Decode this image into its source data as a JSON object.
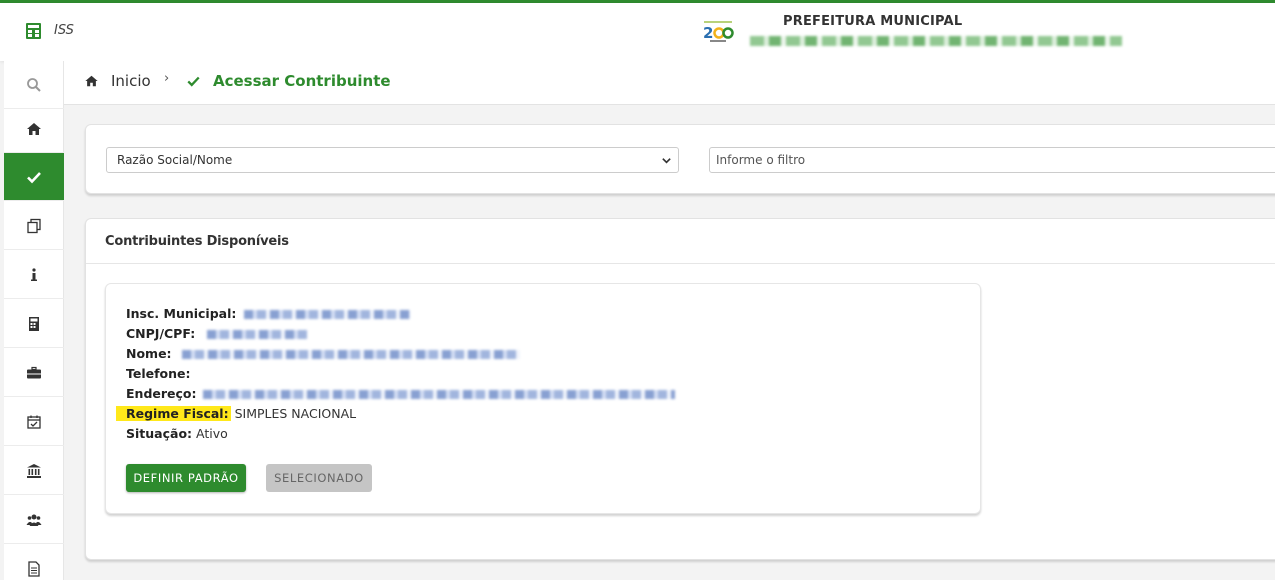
{
  "header": {
    "app_name": "ISS",
    "org_name": "PREFEITURA MUNICIPAL"
  },
  "sidebar": {
    "items": [
      {
        "icon": "search-icon"
      },
      {
        "icon": "home-icon"
      },
      {
        "icon": "check-icon",
        "active": true
      },
      {
        "icon": "copy-icon"
      },
      {
        "icon": "info-icon"
      },
      {
        "icon": "calculator-icon"
      },
      {
        "icon": "briefcase-icon"
      },
      {
        "icon": "calendar-check-icon"
      },
      {
        "icon": "bank-icon"
      },
      {
        "icon": "users-icon"
      },
      {
        "icon": "document-icon"
      }
    ]
  },
  "breadcrumb": {
    "home": "Inicio",
    "separator": "›",
    "current": "Acessar Contribuinte"
  },
  "filter": {
    "select_value": "Razão Social/Nome",
    "input_placeholder": "Informe o filtro"
  },
  "contribuintes": {
    "title": "Contribuintes Disponíveis",
    "labels": {
      "insc": "Insc. Municipal:",
      "cnpj": "CNPJ/CPF:",
      "nome": "Nome:",
      "telefone": "Telefone:",
      "endereco": "Endereço:",
      "regime": "Regime Fiscal:",
      "situacao": "Situação:"
    },
    "values": {
      "regime": "SIMPLES NACIONAL",
      "situacao": "Ativo"
    },
    "buttons": {
      "definir": "DEFINIR PADRÃO",
      "selecionado": "SELECIONADO"
    }
  },
  "colors": {
    "accent": "#2e8b2e",
    "highlight": "#ffe81a"
  }
}
